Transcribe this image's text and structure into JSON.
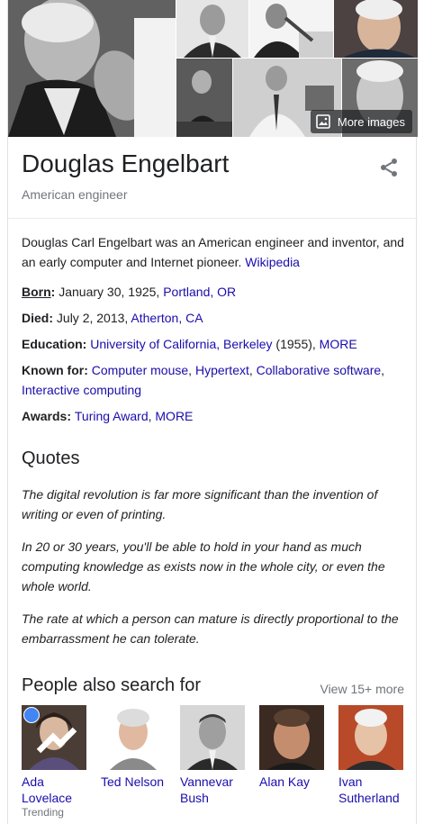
{
  "images": {
    "more_images_label": "More images"
  },
  "header": {
    "name": "Douglas Engelbart",
    "subtitle": "American engineer"
  },
  "description": {
    "text": "Douglas Carl Engelbart was an American engineer and inventor, and an early computer and Internet pioneer.",
    "source_link": "Wikipedia"
  },
  "facts": {
    "born": {
      "label": "Born",
      "value": "January 30, 1925, ",
      "link": "Portland, OR"
    },
    "died": {
      "label": "Died",
      "value": "July 2, 2013, ",
      "link": "Atherton, CA"
    },
    "education": {
      "label": "Education",
      "link1": "University of California, Berkeley",
      "value": " (1955), ",
      "link2": "MORE"
    },
    "known_for": {
      "label": "Known for",
      "links": [
        "Computer mouse",
        "Hypertext",
        "Collaborative software",
        "Interactive computing"
      ]
    },
    "awards": {
      "label": "Awards",
      "links": [
        "Turing Award",
        "MORE"
      ]
    }
  },
  "quotes": {
    "title": "Quotes",
    "items": [
      "The digital revolution is far more significant than the invention of writing or even of printing.",
      "In 20 or 30 years, you'll be able to hold in your hand as much computing knowledge as exists now in the whole city, or even the whole world.",
      "The rate at which a person can mature is directly proportional to the embarrassment he can tolerate."
    ]
  },
  "people_also_search": {
    "title": "People also search for",
    "view_more": "View 15+ more",
    "people": [
      {
        "name": "Ada Lovelace",
        "sub": "Trending"
      },
      {
        "name": "Ted Nelson",
        "sub": ""
      },
      {
        "name": "Vannevar Bush",
        "sub": ""
      },
      {
        "name": "Alan Kay",
        "sub": ""
      },
      {
        "name": "Ivan Sutherland",
        "sub": ""
      }
    ]
  },
  "colors": {
    "link": "#1a0dab",
    "secondary_text": "#70757a",
    "text": "#202124",
    "divider": "#ebebeb"
  }
}
